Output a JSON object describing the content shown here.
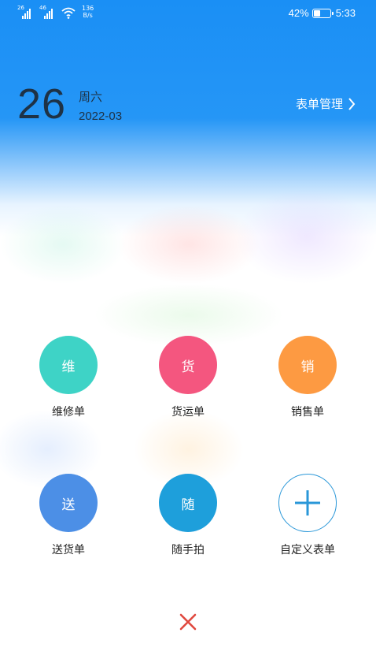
{
  "status_bar": {
    "sim1_tag": "26",
    "sim2_tag": "46",
    "net_speed_value": "136",
    "net_speed_unit": "B/s",
    "battery_percent": "42%",
    "battery_level": 0.42,
    "time": "5:33"
  },
  "header": {
    "day": "26",
    "weekday": "周六",
    "year_month": "2022-03",
    "form_manage_label": "表单管理"
  },
  "forms": [
    {
      "icon_text": "维",
      "label": "维修单",
      "color": "#3ed3c6"
    },
    {
      "icon_text": "货",
      "label": "货运单",
      "color": "#f4567f"
    },
    {
      "icon_text": "销",
      "label": "销售单",
      "color": "#fd9a42"
    },
    {
      "icon_text": "送",
      "label": "送货单",
      "color": "#4c8fe6"
    },
    {
      "icon_text": "随",
      "label": "随手拍",
      "color": "#1e9fdb"
    },
    {
      "icon_text": "",
      "label": "自定义表单",
      "color": "#2a97d8",
      "icon": "plus-icon"
    }
  ],
  "close": {
    "icon": "close-icon",
    "color": "#e0483e"
  }
}
